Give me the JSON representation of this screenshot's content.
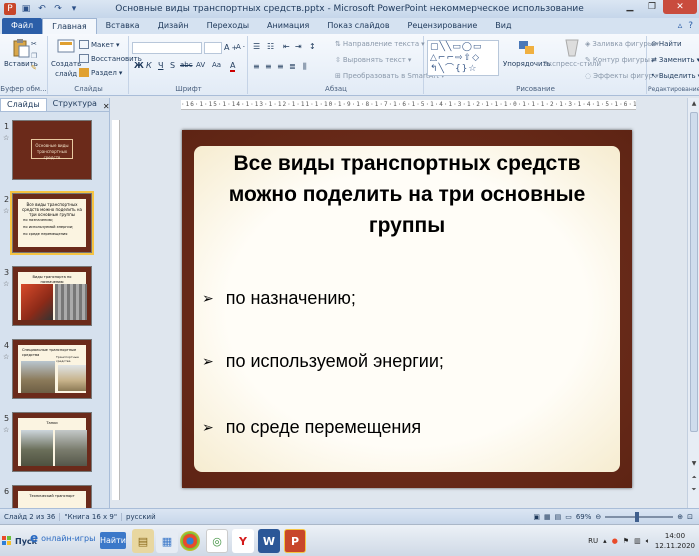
{
  "window": {
    "title": "Основные виды транспортных средств.pptx - Microsoft PowerPoint некоммерческое использование"
  },
  "tabs": [
    "Файл",
    "Главная",
    "Вставка",
    "Дизайн",
    "Переходы",
    "Анимация",
    "Показ слайдов",
    "Рецензирование",
    "Вид"
  ],
  "ribbon": {
    "clipboard": {
      "paste": "Вставить",
      "group": "Буфер обм..."
    },
    "slides": {
      "create": "Создать",
      "create2": "слайд",
      "layout": "Макет",
      "reset": "Восстановить",
      "section": "Раздел",
      "group": "Слайды"
    },
    "font": {
      "group": "Шрифт",
      "size_a": "A",
      "bold": "Ж",
      "italic": "К",
      "underline": "Ч",
      "strike": "S",
      "abc": "abc",
      "spacing": "AV",
      "case": "Aa",
      "color": "A"
    },
    "paragraph": {
      "text_direction": "Направление текста",
      "align_text": "Выровнять текст",
      "smartart": "Преобразовать в SmartArt",
      "group": "Абзац"
    },
    "drawing": {
      "arrange": "Упорядочить",
      "styles": "Экспресс-стили",
      "fill": "Заливка фигуры",
      "outline": "Контур фигуры",
      "effects": "Эффекты фигур",
      "group": "Рисование"
    },
    "editing": {
      "find": "Найти",
      "replace": "Заменить",
      "select": "Выделить",
      "group": "Редактирование"
    }
  },
  "left_panel": {
    "tabs": [
      "Слайды",
      "Структура"
    ],
    "thumbnails": [
      {
        "num": "1",
        "title": "Основные виды транспортных средств"
      },
      {
        "num": "2",
        "title": "Все виды транспортных средств можно поделить на три основные группы",
        "items": [
          "по назначению;",
          "по используемой энергии;",
          "по среде перемещения"
        ]
      },
      {
        "num": "3",
        "title": "Виды транспорта по назначению"
      },
      {
        "num": "4",
        "title": "Специальные транспортные средства",
        "caption": "Транспортные средства"
      },
      {
        "num": "5",
        "title": "Танки"
      },
      {
        "num": "6",
        "title": "Технический транспорт"
      }
    ]
  },
  "ruler": {
    "marks": "·16·1·15·1·14·1·13·1·12·1·11·1·10·1·9·1·8·1·7·1·6·1·5·1·4·1·3·1·2·1·1·1·0·1·1·1·2·1·3·1·4·1·5·1·6·1·7·1·8·1·9·1·10·1·11·1·12·1·13·1·14·1·15·1·16·"
  },
  "slide": {
    "title": "Все виды транспортных средств можно поделить на три основные группы",
    "bullets": [
      "по назначению;",
      "по используемой энергии;",
      "по среде перемещения"
    ]
  },
  "status": {
    "slide_info": "Слайд 2 из 36",
    "theme": "\"Книга 16 x 9\"",
    "language": "русский",
    "zoom": "69%"
  },
  "taskbar": {
    "start": "Пуск",
    "search": "онлайн-игры",
    "find": "Найти",
    "lang": "RU",
    "time": "14:00",
    "date": "12.11.2020"
  }
}
